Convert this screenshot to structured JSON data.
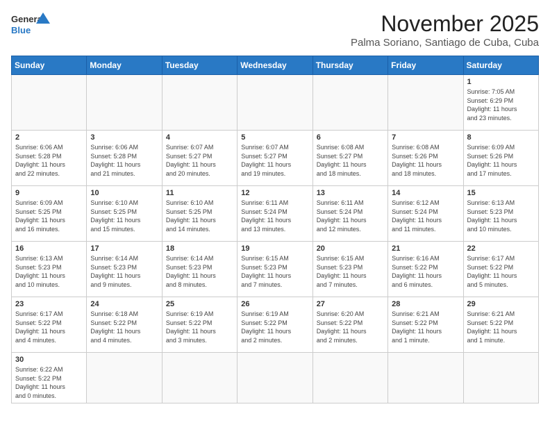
{
  "header": {
    "logo_general": "General",
    "logo_blue": "Blue",
    "month": "November 2025",
    "location": "Palma Soriano, Santiago de Cuba, Cuba"
  },
  "weekdays": [
    "Sunday",
    "Monday",
    "Tuesday",
    "Wednesday",
    "Thursday",
    "Friday",
    "Saturday"
  ],
  "weeks": [
    [
      {
        "day": "",
        "info": ""
      },
      {
        "day": "",
        "info": ""
      },
      {
        "day": "",
        "info": ""
      },
      {
        "day": "",
        "info": ""
      },
      {
        "day": "",
        "info": ""
      },
      {
        "day": "",
        "info": ""
      },
      {
        "day": "1",
        "info": "Sunrise: 7:05 AM\nSunset: 6:29 PM\nDaylight: 11 hours\nand 23 minutes."
      }
    ],
    [
      {
        "day": "2",
        "info": "Sunrise: 6:06 AM\nSunset: 5:28 PM\nDaylight: 11 hours\nand 22 minutes."
      },
      {
        "day": "3",
        "info": "Sunrise: 6:06 AM\nSunset: 5:28 PM\nDaylight: 11 hours\nand 21 minutes."
      },
      {
        "day": "4",
        "info": "Sunrise: 6:07 AM\nSunset: 5:27 PM\nDaylight: 11 hours\nand 20 minutes."
      },
      {
        "day": "5",
        "info": "Sunrise: 6:07 AM\nSunset: 5:27 PM\nDaylight: 11 hours\nand 19 minutes."
      },
      {
        "day": "6",
        "info": "Sunrise: 6:08 AM\nSunset: 5:27 PM\nDaylight: 11 hours\nand 18 minutes."
      },
      {
        "day": "7",
        "info": "Sunrise: 6:08 AM\nSunset: 5:26 PM\nDaylight: 11 hours\nand 18 minutes."
      },
      {
        "day": "8",
        "info": "Sunrise: 6:09 AM\nSunset: 5:26 PM\nDaylight: 11 hours\nand 17 minutes."
      }
    ],
    [
      {
        "day": "9",
        "info": "Sunrise: 6:09 AM\nSunset: 5:25 PM\nDaylight: 11 hours\nand 16 minutes."
      },
      {
        "day": "10",
        "info": "Sunrise: 6:10 AM\nSunset: 5:25 PM\nDaylight: 11 hours\nand 15 minutes."
      },
      {
        "day": "11",
        "info": "Sunrise: 6:10 AM\nSunset: 5:25 PM\nDaylight: 11 hours\nand 14 minutes."
      },
      {
        "day": "12",
        "info": "Sunrise: 6:11 AM\nSunset: 5:24 PM\nDaylight: 11 hours\nand 13 minutes."
      },
      {
        "day": "13",
        "info": "Sunrise: 6:11 AM\nSunset: 5:24 PM\nDaylight: 11 hours\nand 12 minutes."
      },
      {
        "day": "14",
        "info": "Sunrise: 6:12 AM\nSunset: 5:24 PM\nDaylight: 11 hours\nand 11 minutes."
      },
      {
        "day": "15",
        "info": "Sunrise: 6:13 AM\nSunset: 5:23 PM\nDaylight: 11 hours\nand 10 minutes."
      }
    ],
    [
      {
        "day": "16",
        "info": "Sunrise: 6:13 AM\nSunset: 5:23 PM\nDaylight: 11 hours\nand 10 minutes."
      },
      {
        "day": "17",
        "info": "Sunrise: 6:14 AM\nSunset: 5:23 PM\nDaylight: 11 hours\nand 9 minutes."
      },
      {
        "day": "18",
        "info": "Sunrise: 6:14 AM\nSunset: 5:23 PM\nDaylight: 11 hours\nand 8 minutes."
      },
      {
        "day": "19",
        "info": "Sunrise: 6:15 AM\nSunset: 5:23 PM\nDaylight: 11 hours\nand 7 minutes."
      },
      {
        "day": "20",
        "info": "Sunrise: 6:15 AM\nSunset: 5:23 PM\nDaylight: 11 hours\nand 7 minutes."
      },
      {
        "day": "21",
        "info": "Sunrise: 6:16 AM\nSunset: 5:22 PM\nDaylight: 11 hours\nand 6 minutes."
      },
      {
        "day": "22",
        "info": "Sunrise: 6:17 AM\nSunset: 5:22 PM\nDaylight: 11 hours\nand 5 minutes."
      }
    ],
    [
      {
        "day": "23",
        "info": "Sunrise: 6:17 AM\nSunset: 5:22 PM\nDaylight: 11 hours\nand 4 minutes."
      },
      {
        "day": "24",
        "info": "Sunrise: 6:18 AM\nSunset: 5:22 PM\nDaylight: 11 hours\nand 4 minutes."
      },
      {
        "day": "25",
        "info": "Sunrise: 6:19 AM\nSunset: 5:22 PM\nDaylight: 11 hours\nand 3 minutes."
      },
      {
        "day": "26",
        "info": "Sunrise: 6:19 AM\nSunset: 5:22 PM\nDaylight: 11 hours\nand 2 minutes."
      },
      {
        "day": "27",
        "info": "Sunrise: 6:20 AM\nSunset: 5:22 PM\nDaylight: 11 hours\nand 2 minutes."
      },
      {
        "day": "28",
        "info": "Sunrise: 6:21 AM\nSunset: 5:22 PM\nDaylight: 11 hours\nand 1 minute."
      },
      {
        "day": "29",
        "info": "Sunrise: 6:21 AM\nSunset: 5:22 PM\nDaylight: 11 hours\nand 1 minute."
      }
    ],
    [
      {
        "day": "30",
        "info": "Sunrise: 6:22 AM\nSunset: 5:22 PM\nDaylight: 11 hours\nand 0 minutes."
      },
      {
        "day": "",
        "info": ""
      },
      {
        "day": "",
        "info": ""
      },
      {
        "day": "",
        "info": ""
      },
      {
        "day": "",
        "info": ""
      },
      {
        "day": "",
        "info": ""
      },
      {
        "day": "",
        "info": ""
      }
    ]
  ]
}
